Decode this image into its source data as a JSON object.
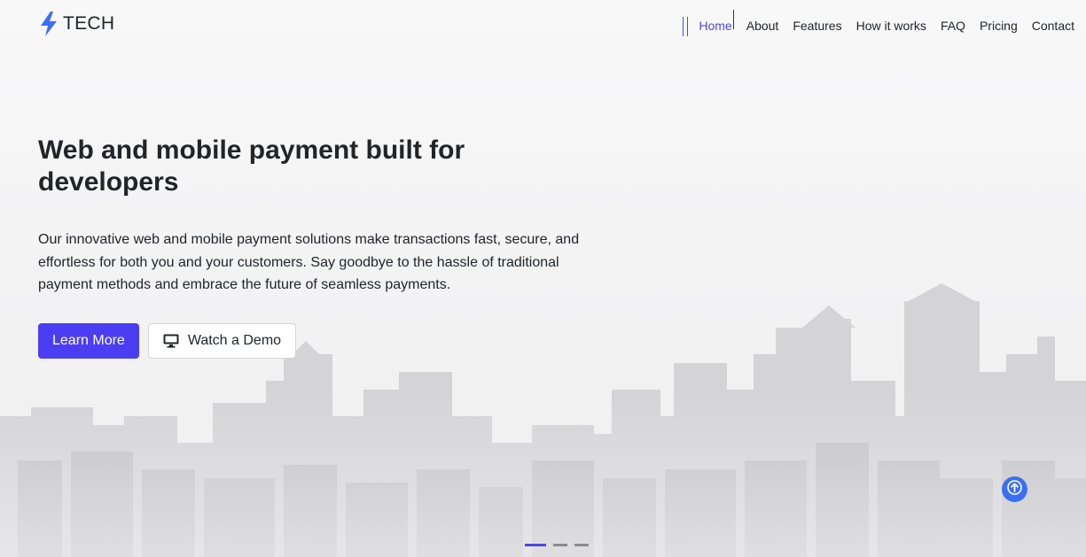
{
  "brand": {
    "name": "TECH",
    "icon": "lightning-bolt-icon",
    "accent_color": "#3b6ff3"
  },
  "nav": {
    "items": [
      {
        "label": "Home",
        "active": true
      },
      {
        "label": "About"
      },
      {
        "label": "Features"
      },
      {
        "label": "How it works"
      },
      {
        "label": "FAQ"
      },
      {
        "label": "Pricing"
      },
      {
        "label": "Contact"
      }
    ]
  },
  "hero": {
    "title": "Web and mobile payment built for developers",
    "description": "Our innovative web and mobile payment solutions make transactions fast, secure, and effortless for both you and your customers. Say goodbye to the hassle of traditional payment methods and embrace the future of seamless payments.",
    "primary_button": "Learn More",
    "secondary_button": "Watch a Demo",
    "secondary_icon": "monitor-icon",
    "primary_color": "#4b3ef2"
  },
  "carousel": {
    "slides": 3,
    "active_index": 0
  },
  "scroll_top": {
    "icon": "arrow-up-icon",
    "color": "#3b6ff3"
  }
}
